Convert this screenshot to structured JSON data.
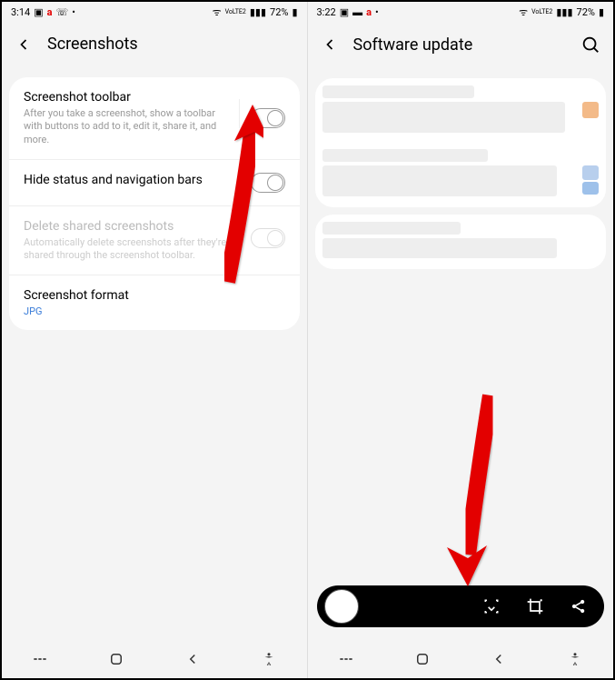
{
  "left": {
    "status": {
      "time": "3:14",
      "battery": "72%"
    },
    "title": "Screenshots",
    "settings": [
      {
        "title": "Screenshot toolbar",
        "desc": "After you take a screenshot, show a toolbar with buttons to add to it, edit it, share it, and more."
      },
      {
        "title": "Hide status and navigation bars"
      },
      {
        "title": "Delete shared screenshots",
        "desc": "Automatically delete screenshots after they're shared through the screenshot toolbar."
      },
      {
        "title": "Screenshot format",
        "value": "JPG"
      }
    ]
  },
  "right": {
    "status": {
      "time": "3:22",
      "battery": "72%"
    },
    "title": "Software update"
  }
}
